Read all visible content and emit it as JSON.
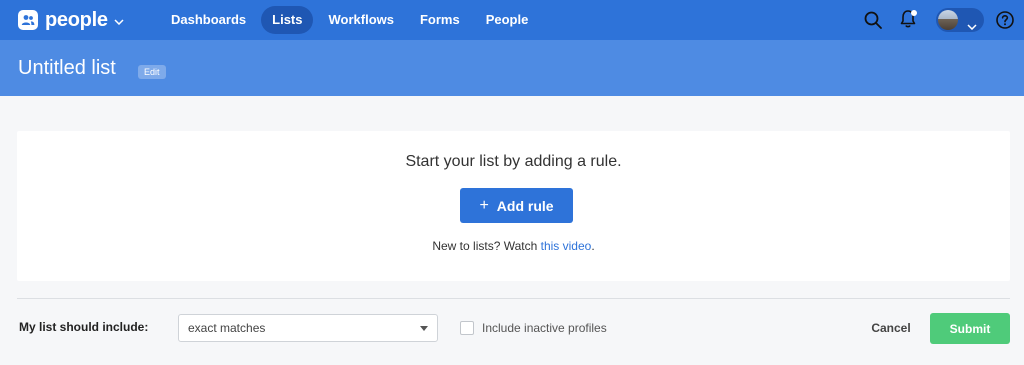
{
  "app": {
    "name": "people",
    "logo_icon": "people-logo-icon"
  },
  "nav": {
    "items": [
      {
        "label": "Dashboards",
        "active": false
      },
      {
        "label": "Lists",
        "active": true
      },
      {
        "label": "Workflows",
        "active": false
      },
      {
        "label": "Forms",
        "active": false
      },
      {
        "label": "People",
        "active": false
      }
    ]
  },
  "header_icons": [
    "search-icon",
    "bell-icon",
    "avatar",
    "help-icon"
  ],
  "page": {
    "title": "Untitled list",
    "edit_label": "Edit"
  },
  "card": {
    "heading": "Start your list by adding a rule.",
    "add_rule_label": "Add rule",
    "help_prefix": "New to lists? Watch ",
    "help_link": "this video",
    "help_suffix": "."
  },
  "footer": {
    "include_label": "My list should include:",
    "match_select": {
      "value": "exact matches"
    },
    "inactive_checkbox": {
      "label": "Include inactive profiles",
      "checked": false
    },
    "cancel_label": "Cancel",
    "submit_label": "Submit"
  },
  "colors": {
    "nav_bg": "#2e73d9",
    "nav_active": "#1f57b3",
    "title_bg": "#4e8be3",
    "primary": "#2e73d9",
    "submit": "#4fcb7a",
    "notification_dot": "#ffffff"
  }
}
